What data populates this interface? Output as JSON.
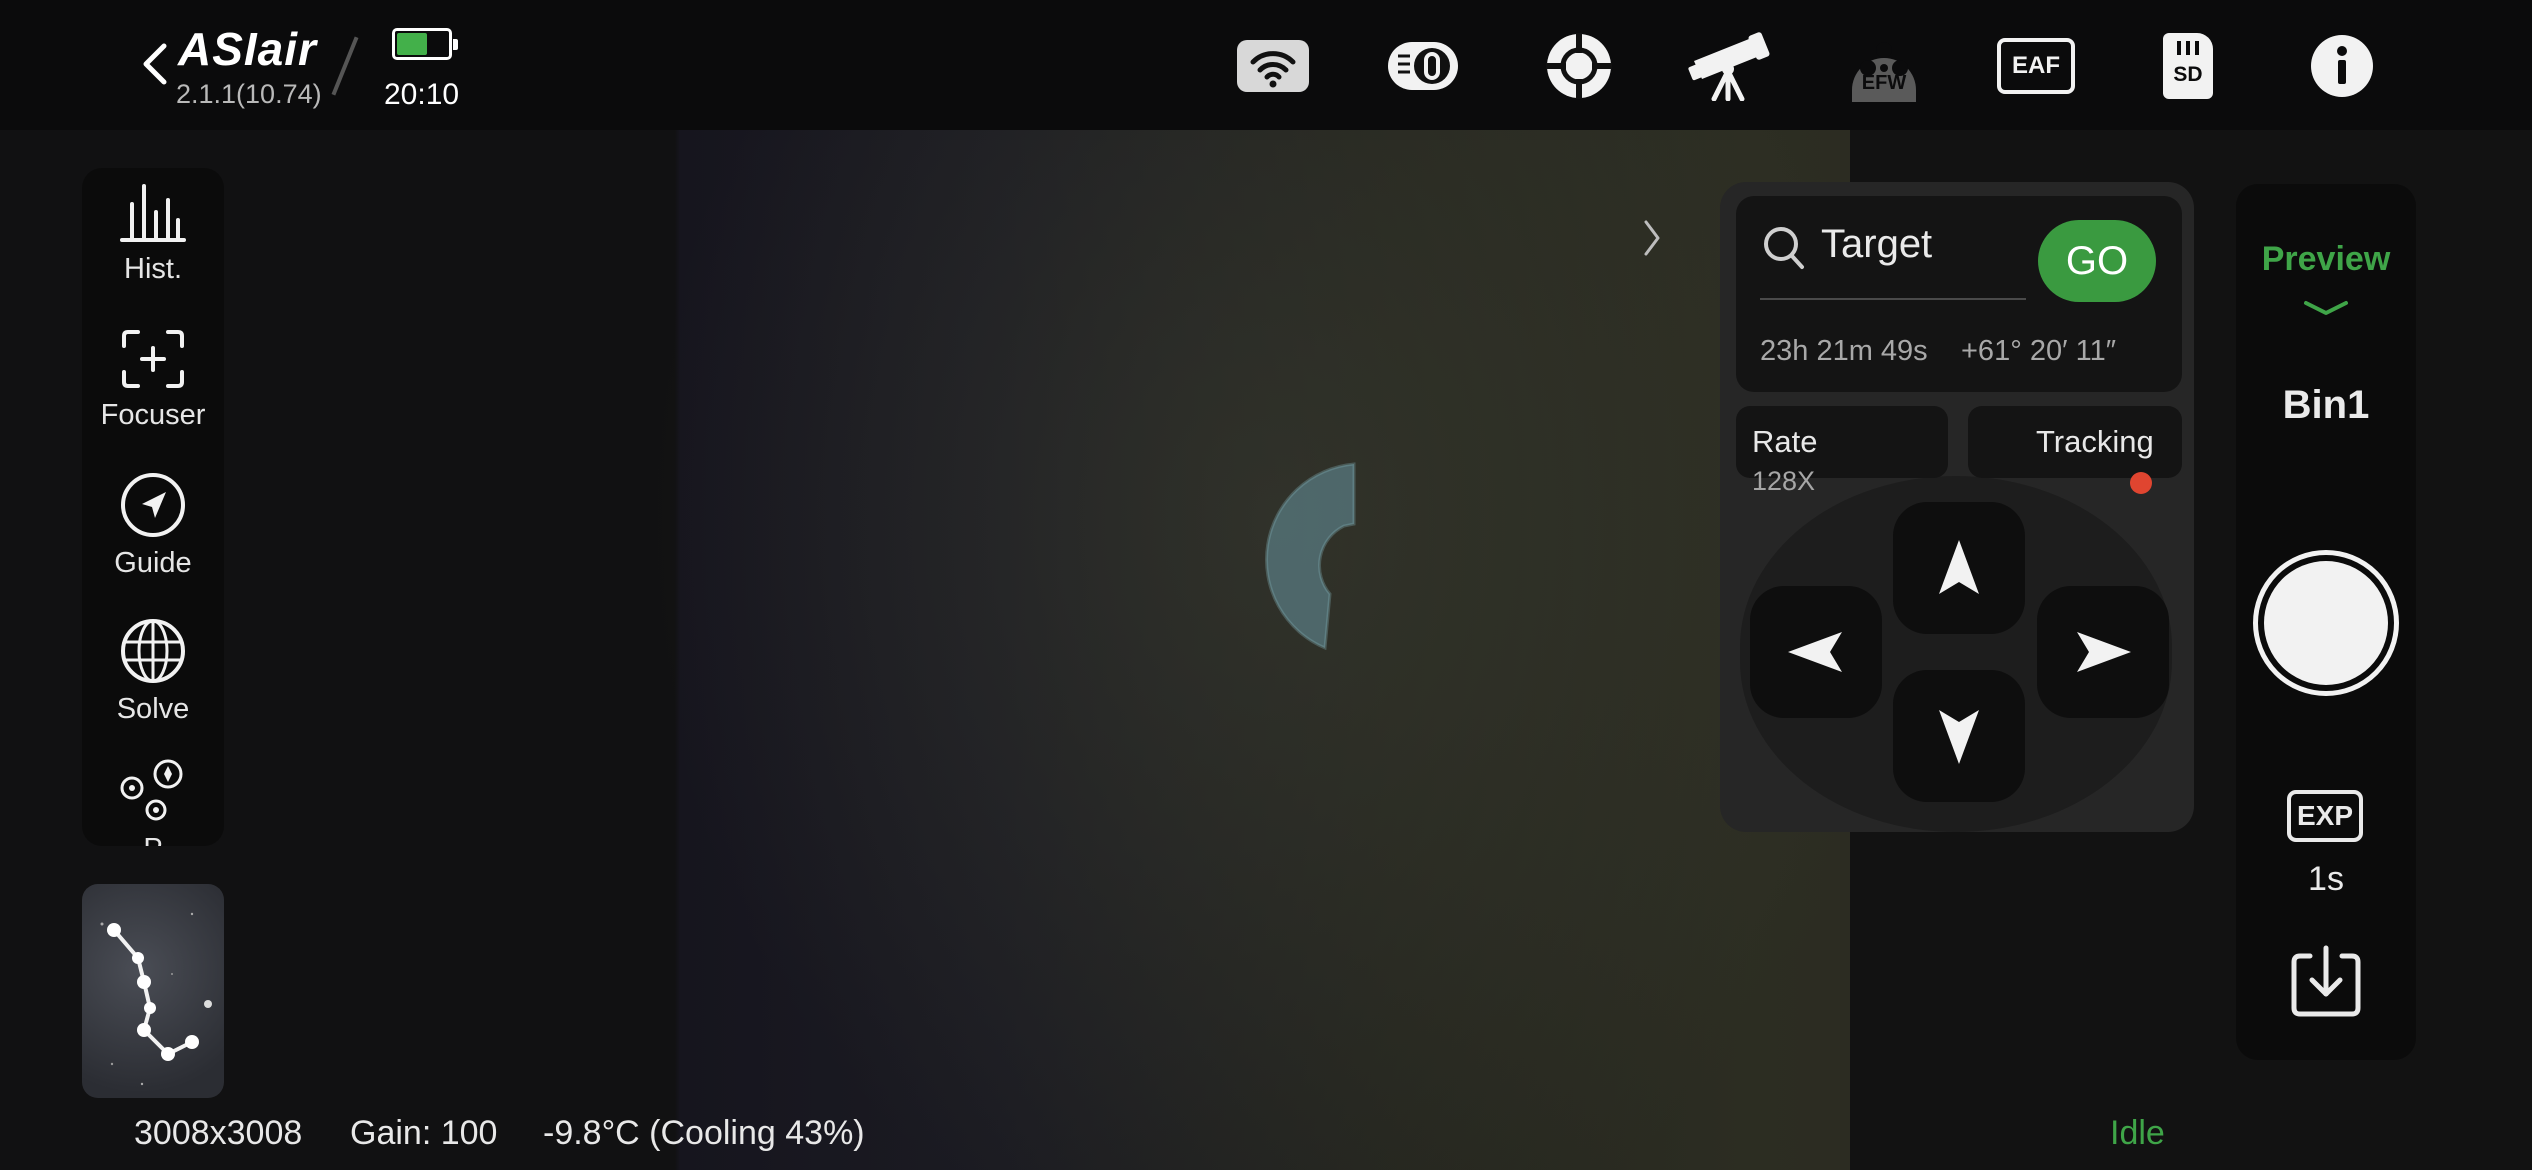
{
  "header": {
    "brand": "ASIair",
    "version": "2.1.1(10.74)",
    "time": "20:10",
    "battery_color": "#43b04a",
    "icons": [
      "wifi-icon",
      "filter-wheel-icon",
      "guide-target-icon",
      "telescope-icon",
      "efw-icon",
      "eaf-icon",
      "sd-card-icon",
      "info-icon"
    ],
    "efw_label": "EFW",
    "eaf_label": "EAF",
    "sd_label": "SD"
  },
  "tools": [
    {
      "label": "Hist.",
      "icon": "histogram-icon"
    },
    {
      "label": "Focuser",
      "icon": "focuser-icon"
    },
    {
      "label": "Guide",
      "icon": "guide-compass-icon"
    },
    {
      "label": "Solve",
      "icon": "globe-icon"
    },
    {
      "label": "P",
      "icon": "polar-align-icon"
    }
  ],
  "mount": {
    "search_placeholder": "Target",
    "go_label": "GO",
    "ra": "23h 21m 49s",
    "dec": "+61° 20′ 11″",
    "rate_label": "Rate",
    "rate_value": "128X",
    "tracking_label": "Tracking",
    "tracking_dot_color": "#e04530"
  },
  "camera": {
    "mode": "Preview",
    "bin": "Bin1",
    "exp_icon_label": "EXP",
    "exposure": "1s",
    "accent": "#3fa548"
  },
  "status": {
    "resolution": "3008x3008",
    "gain": "Gain: 100",
    "temperature": "-9.8°C (Cooling 43%)",
    "state": "Idle"
  }
}
